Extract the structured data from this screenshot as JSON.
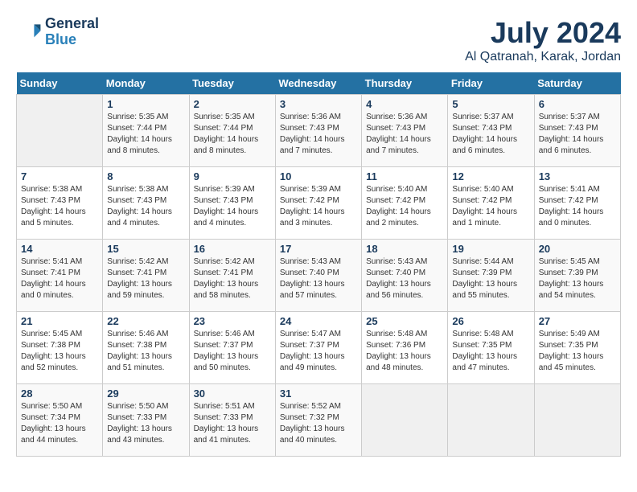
{
  "header": {
    "logo_line1": "General",
    "logo_line2": "Blue",
    "month": "July 2024",
    "location": "Al Qatranah, Karak, Jordan"
  },
  "days_of_week": [
    "Sunday",
    "Monday",
    "Tuesday",
    "Wednesday",
    "Thursday",
    "Friday",
    "Saturday"
  ],
  "weeks": [
    [
      {
        "date": "",
        "sunrise": "",
        "sunset": "",
        "daylight": ""
      },
      {
        "date": "1",
        "sunrise": "5:35 AM",
        "sunset": "7:44 PM",
        "daylight": "14 hours and 8 minutes."
      },
      {
        "date": "2",
        "sunrise": "5:35 AM",
        "sunset": "7:44 PM",
        "daylight": "14 hours and 8 minutes."
      },
      {
        "date": "3",
        "sunrise": "5:36 AM",
        "sunset": "7:43 PM",
        "daylight": "14 hours and 7 minutes."
      },
      {
        "date": "4",
        "sunrise": "5:36 AM",
        "sunset": "7:43 PM",
        "daylight": "14 hours and 7 minutes."
      },
      {
        "date": "5",
        "sunrise": "5:37 AM",
        "sunset": "7:43 PM",
        "daylight": "14 hours and 6 minutes."
      },
      {
        "date": "6",
        "sunrise": "5:37 AM",
        "sunset": "7:43 PM",
        "daylight": "14 hours and 6 minutes."
      }
    ],
    [
      {
        "date": "7",
        "sunrise": "5:38 AM",
        "sunset": "7:43 PM",
        "daylight": "14 hours and 5 minutes."
      },
      {
        "date": "8",
        "sunrise": "5:38 AM",
        "sunset": "7:43 PM",
        "daylight": "14 hours and 4 minutes."
      },
      {
        "date": "9",
        "sunrise": "5:39 AM",
        "sunset": "7:43 PM",
        "daylight": "14 hours and 4 minutes."
      },
      {
        "date": "10",
        "sunrise": "5:39 AM",
        "sunset": "7:42 PM",
        "daylight": "14 hours and 3 minutes."
      },
      {
        "date": "11",
        "sunrise": "5:40 AM",
        "sunset": "7:42 PM",
        "daylight": "14 hours and 2 minutes."
      },
      {
        "date": "12",
        "sunrise": "5:40 AM",
        "sunset": "7:42 PM",
        "daylight": "14 hours and 1 minute."
      },
      {
        "date": "13",
        "sunrise": "5:41 AM",
        "sunset": "7:42 PM",
        "daylight": "14 hours and 0 minutes."
      }
    ],
    [
      {
        "date": "14",
        "sunrise": "5:41 AM",
        "sunset": "7:41 PM",
        "daylight": "14 hours and 0 minutes."
      },
      {
        "date": "15",
        "sunrise": "5:42 AM",
        "sunset": "7:41 PM",
        "daylight": "13 hours and 59 minutes."
      },
      {
        "date": "16",
        "sunrise": "5:42 AM",
        "sunset": "7:41 PM",
        "daylight": "13 hours and 58 minutes."
      },
      {
        "date": "17",
        "sunrise": "5:43 AM",
        "sunset": "7:40 PM",
        "daylight": "13 hours and 57 minutes."
      },
      {
        "date": "18",
        "sunrise": "5:43 AM",
        "sunset": "7:40 PM",
        "daylight": "13 hours and 56 minutes."
      },
      {
        "date": "19",
        "sunrise": "5:44 AM",
        "sunset": "7:39 PM",
        "daylight": "13 hours and 55 minutes."
      },
      {
        "date": "20",
        "sunrise": "5:45 AM",
        "sunset": "7:39 PM",
        "daylight": "13 hours and 54 minutes."
      }
    ],
    [
      {
        "date": "21",
        "sunrise": "5:45 AM",
        "sunset": "7:38 PM",
        "daylight": "13 hours and 52 minutes."
      },
      {
        "date": "22",
        "sunrise": "5:46 AM",
        "sunset": "7:38 PM",
        "daylight": "13 hours and 51 minutes."
      },
      {
        "date": "23",
        "sunrise": "5:46 AM",
        "sunset": "7:37 PM",
        "daylight": "13 hours and 50 minutes."
      },
      {
        "date": "24",
        "sunrise": "5:47 AM",
        "sunset": "7:37 PM",
        "daylight": "13 hours and 49 minutes."
      },
      {
        "date": "25",
        "sunrise": "5:48 AM",
        "sunset": "7:36 PM",
        "daylight": "13 hours and 48 minutes."
      },
      {
        "date": "26",
        "sunrise": "5:48 AM",
        "sunset": "7:35 PM",
        "daylight": "13 hours and 47 minutes."
      },
      {
        "date": "27",
        "sunrise": "5:49 AM",
        "sunset": "7:35 PM",
        "daylight": "13 hours and 45 minutes."
      }
    ],
    [
      {
        "date": "28",
        "sunrise": "5:50 AM",
        "sunset": "7:34 PM",
        "daylight": "13 hours and 44 minutes."
      },
      {
        "date": "29",
        "sunrise": "5:50 AM",
        "sunset": "7:33 PM",
        "daylight": "13 hours and 43 minutes."
      },
      {
        "date": "30",
        "sunrise": "5:51 AM",
        "sunset": "7:33 PM",
        "daylight": "13 hours and 41 minutes."
      },
      {
        "date": "31",
        "sunrise": "5:52 AM",
        "sunset": "7:32 PM",
        "daylight": "13 hours and 40 minutes."
      },
      {
        "date": "",
        "sunrise": "",
        "sunset": "",
        "daylight": ""
      },
      {
        "date": "",
        "sunrise": "",
        "sunset": "",
        "daylight": ""
      },
      {
        "date": "",
        "sunrise": "",
        "sunset": "",
        "daylight": ""
      }
    ]
  ]
}
